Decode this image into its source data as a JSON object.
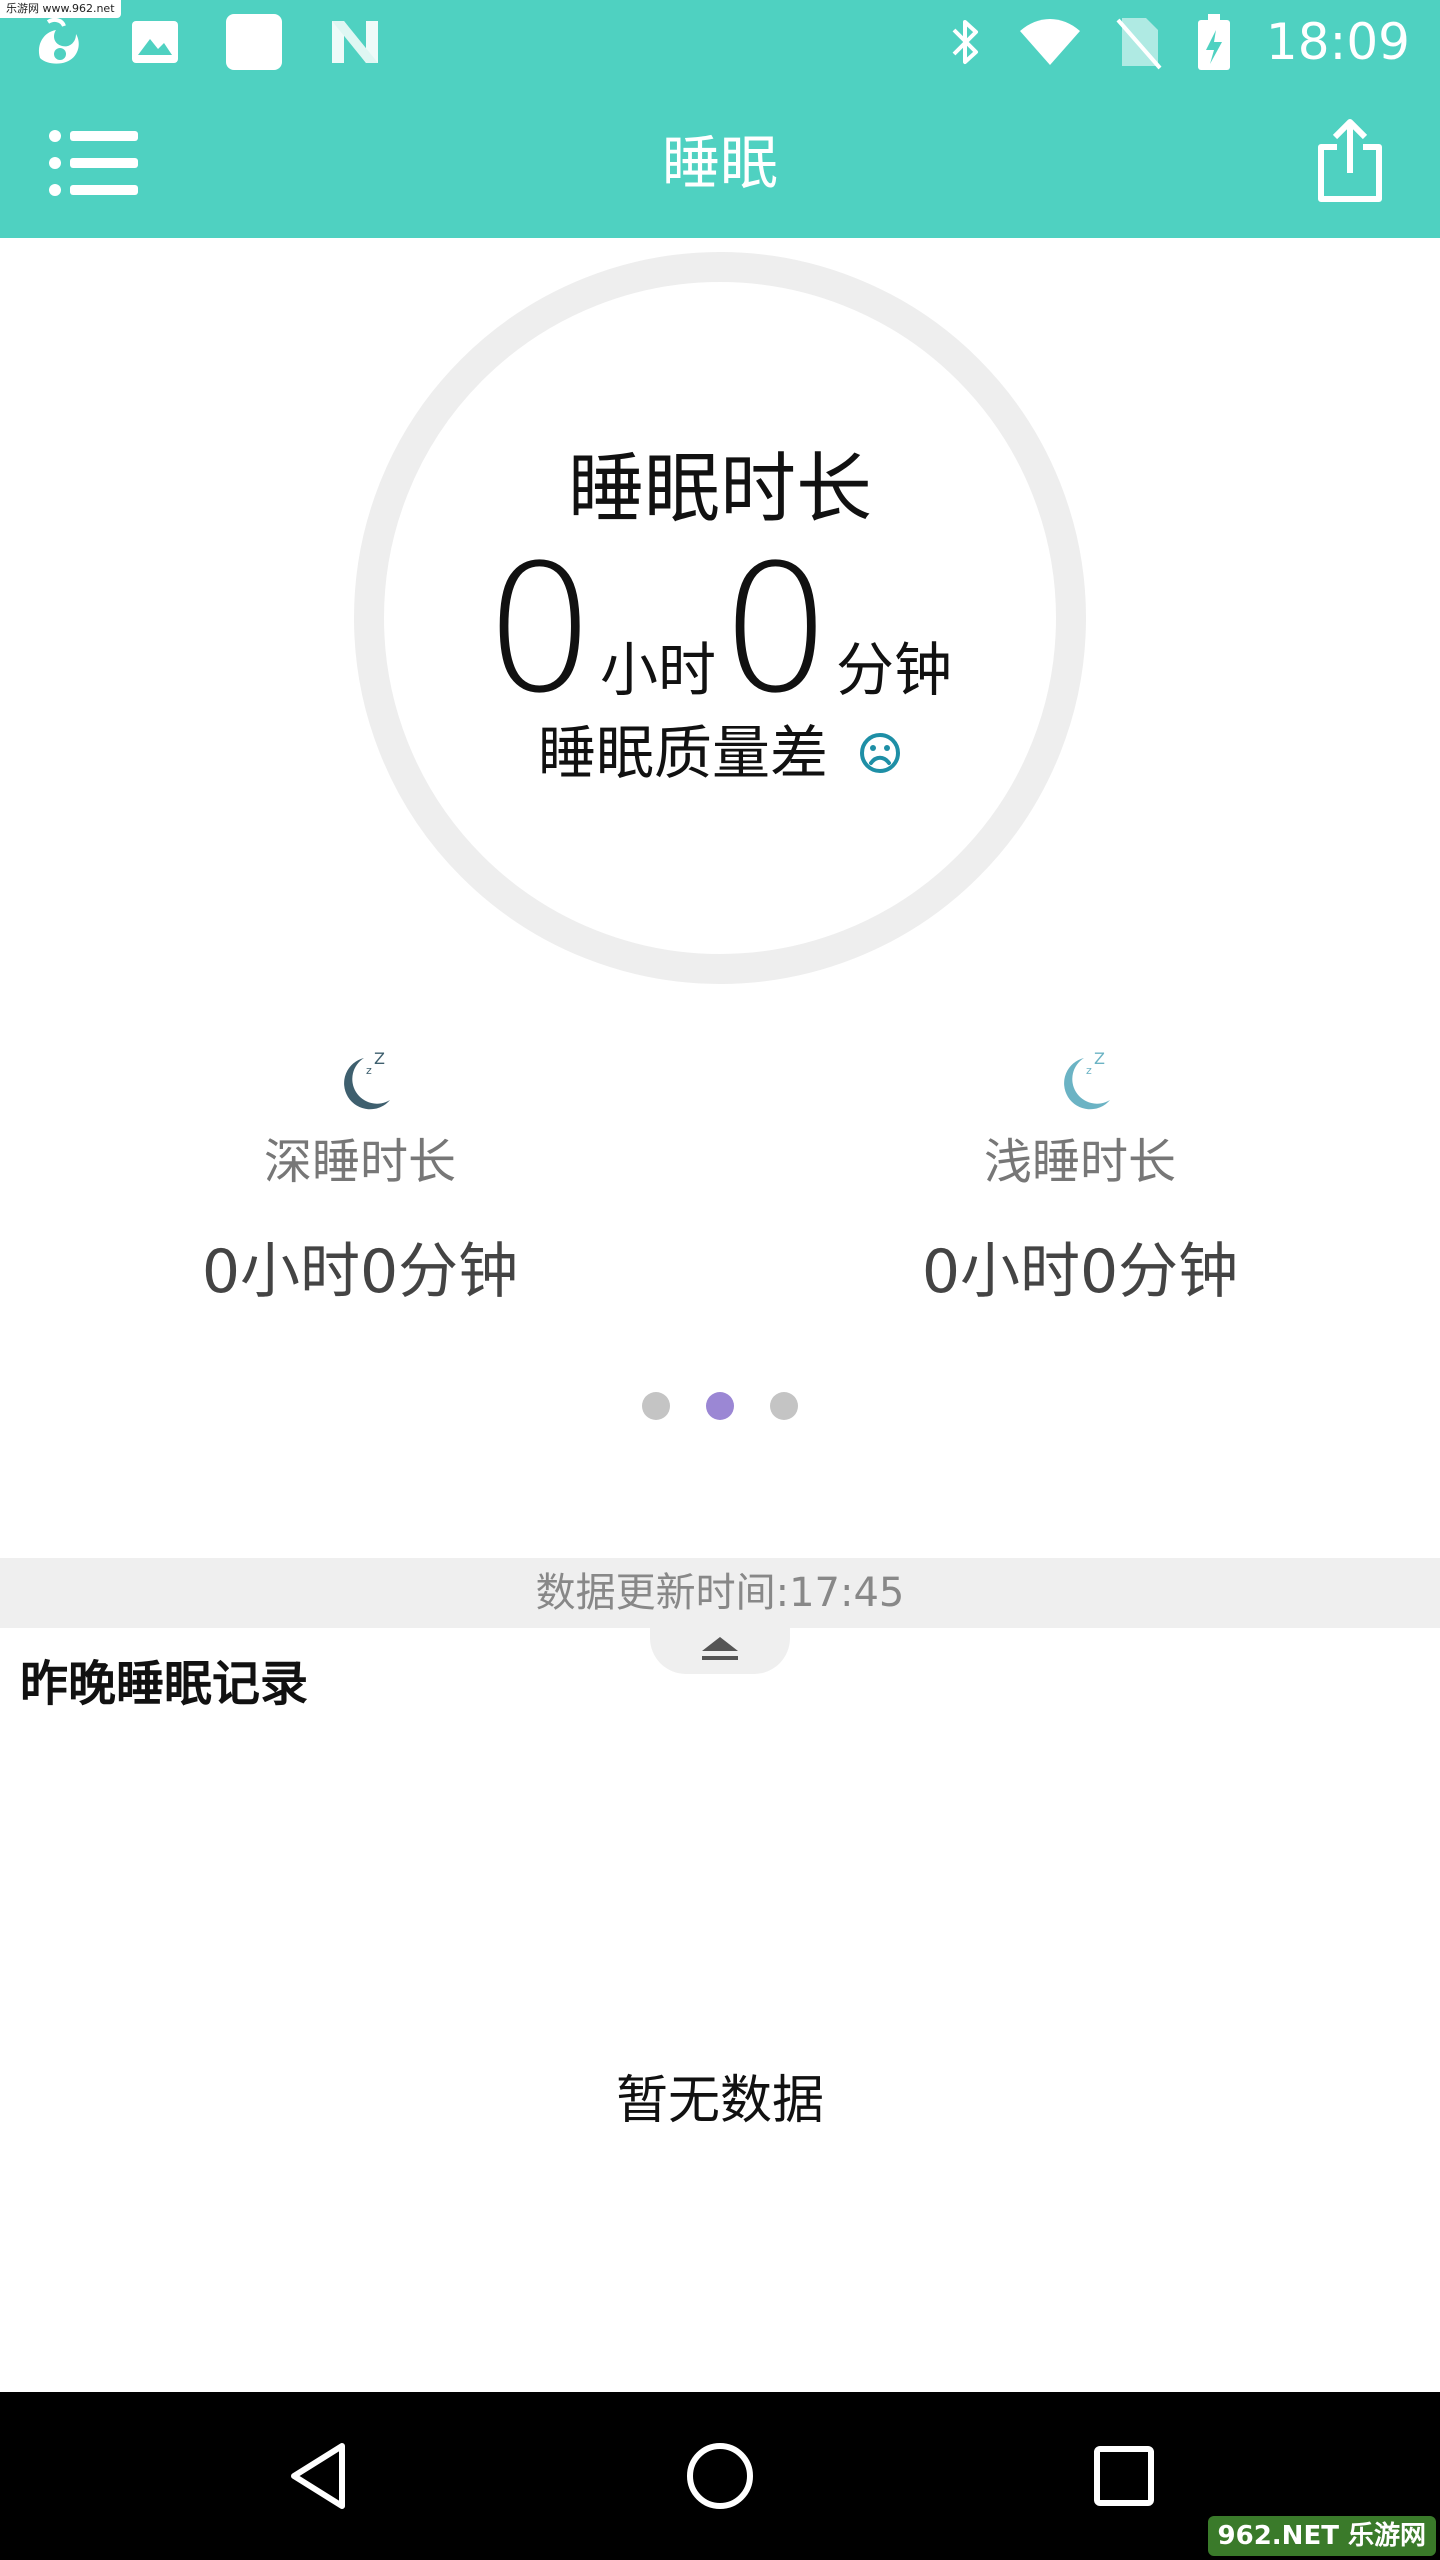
{
  "watermark_top": "乐游网 www.962.net",
  "status_bar": {
    "time": "18:09",
    "left_icons": [
      "uc-browser-icon",
      "image-icon",
      "square-app-icon",
      "n-app-icon"
    ],
    "right_icons": [
      "bluetooth-icon",
      "wifi-icon",
      "no-sim-icon",
      "battery-charging-icon"
    ]
  },
  "app_bar": {
    "title": "睡眠",
    "menu_icon": "menu-list-icon",
    "share_icon": "share-icon"
  },
  "summary": {
    "label": "睡眠时长",
    "hours": "0",
    "hours_unit": "小时",
    "minutes": "0",
    "minutes_unit": "分钟",
    "quality": "睡眠质量差",
    "quality_icon": "sad-face-icon"
  },
  "deep_sleep": {
    "label": "深睡时长",
    "value": "0小时0分钟",
    "icon": "moon-deep-icon",
    "color": "#3e5f6e"
  },
  "light_sleep": {
    "label": "浅睡时长",
    "value": "0小时0分钟",
    "icon": "moon-light-icon",
    "color": "#6bb3c4"
  },
  "pager": {
    "count": 3,
    "active_index": 1
  },
  "update": {
    "text": "数据更新时间:17:45"
  },
  "records": {
    "title": "昨晚睡眠记录",
    "empty": "暂无数据"
  },
  "nav": [
    "back-icon",
    "home-icon",
    "recents-icon"
  ],
  "watermark_bottom": "962.NET 乐游网",
  "colors": {
    "accent": "#4fd1c1",
    "ring": "#eeeeee",
    "dot_active": "#9b87d4",
    "dot_inactive": "#c4c4c4",
    "sad_face": "#1e8fa6"
  }
}
